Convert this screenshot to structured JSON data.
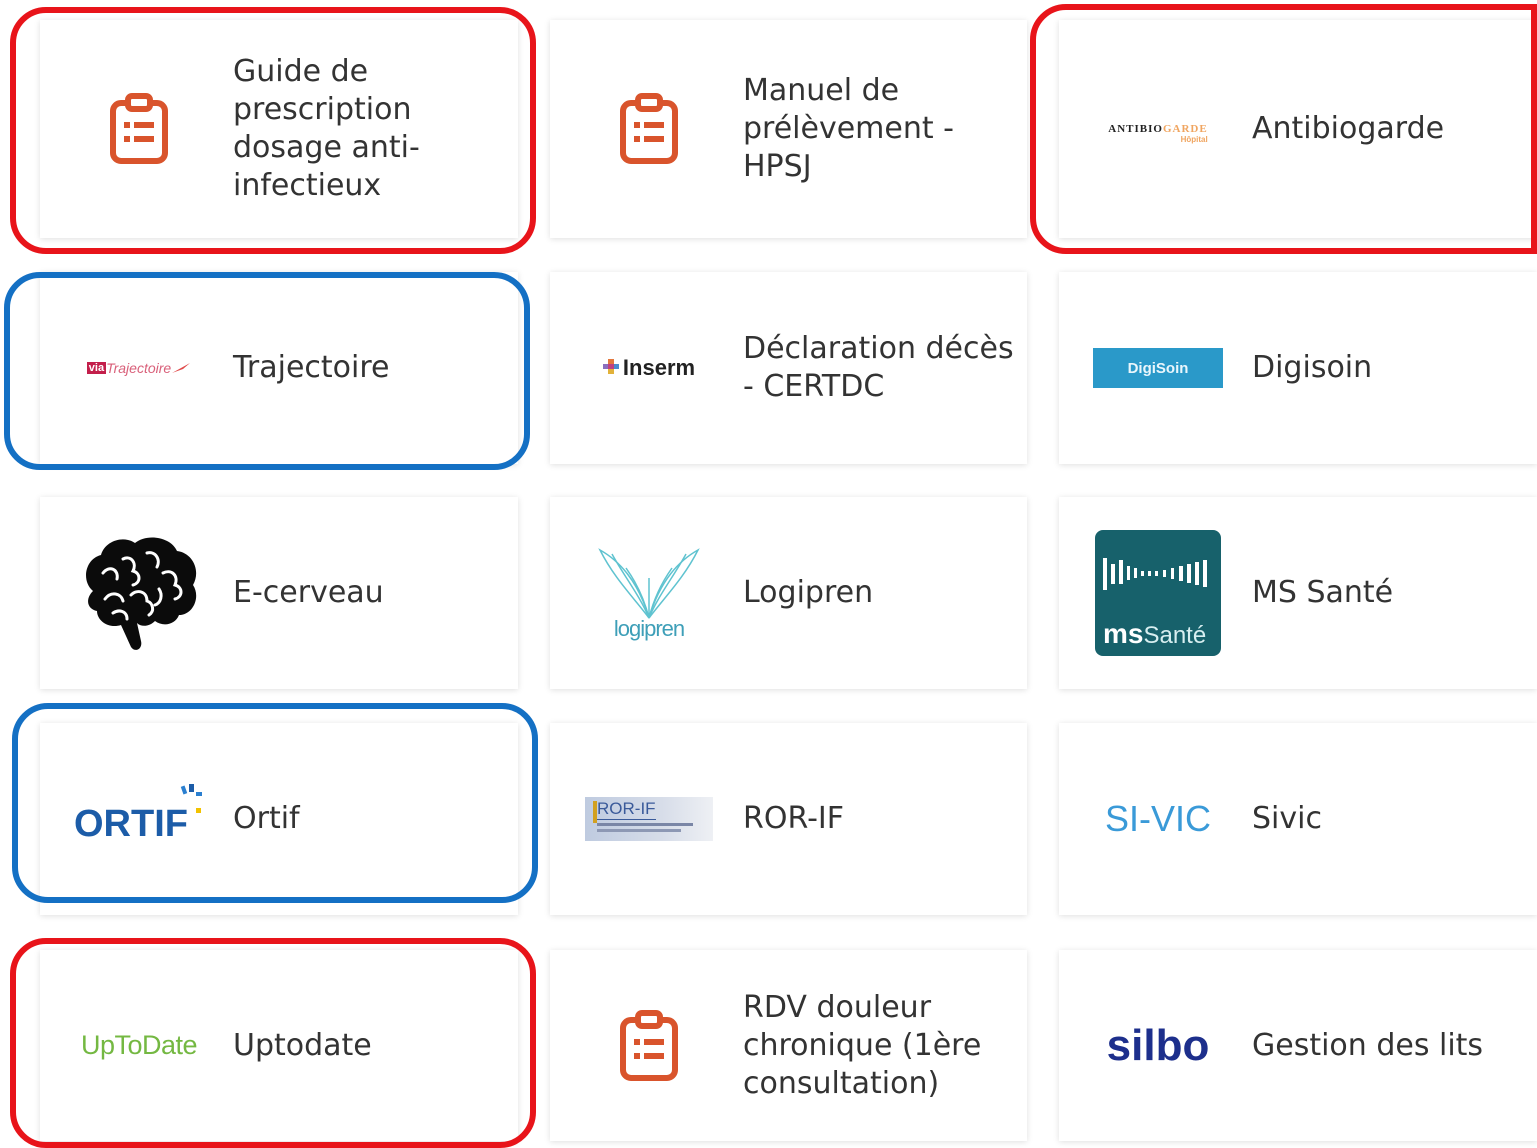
{
  "colors": {
    "highlight_red": "#e8141a",
    "highlight_blue": "#1470c4",
    "clipboard_icon": "#d9542c",
    "card_text": "#333333"
  },
  "cards": [
    {
      "label": "Guide de prescription dosage anti-infectieux",
      "icon": "clipboard-icon"
    },
    {
      "label": "Manuel de prélèvement - HPSJ",
      "icon": "clipboard-icon"
    },
    {
      "label": "Antibiogarde",
      "logo_text_1": "ANTIBIO",
      "logo_text_2": "GARDE",
      "logo_text_3": "Hôpital"
    },
    {
      "label": "Trajectoire",
      "logo_text_1": "via",
      "logo_text_2": "Trajectoire"
    },
    {
      "label": "Déclaration décès - CERTDC",
      "logo_text_1": "Inserm"
    },
    {
      "label": "Digisoin",
      "logo_text_1": "DigiSoin"
    },
    {
      "label": "E-cerveau",
      "icon": "brain-icon"
    },
    {
      "label": "Logipren",
      "logo_text_1": "logipren"
    },
    {
      "label": "MS Santé",
      "logo_text_1": "ms",
      "logo_text_2": "Santé"
    },
    {
      "label": "Ortif",
      "logo_text_1": "ORTIF"
    },
    {
      "label": "ROR-IF",
      "logo_text_1": "ROR-IF"
    },
    {
      "label": "Sivic",
      "logo_text_1": "SI-VIC"
    },
    {
      "label": "Uptodate",
      "logo_text_1": "UpToDate"
    },
    {
      "label": "RDV douleur chronique (1ère consultation)",
      "icon": "clipboard-icon"
    },
    {
      "label": "Gestion des lits",
      "logo_text_1": "silbo"
    }
  ]
}
